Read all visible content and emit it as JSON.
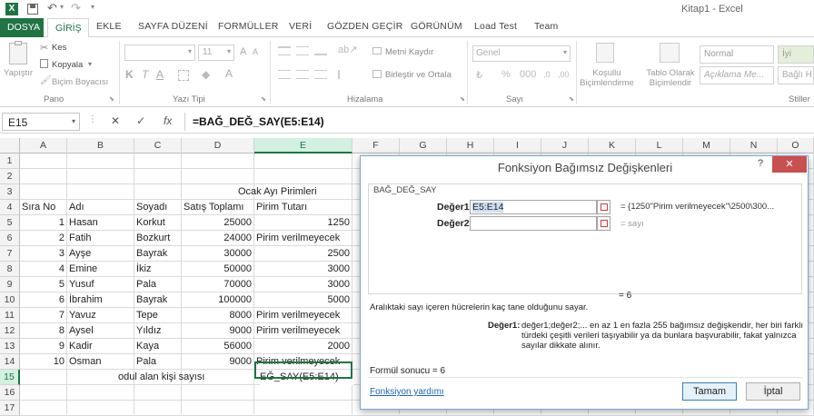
{
  "window": {
    "title": "Kitap1 - Excel",
    "quick_access": [
      "save-icon",
      "undo-icon",
      "redo-icon"
    ]
  },
  "tabs": [
    {
      "label": "DOSYA",
      "active": false,
      "file": true
    },
    {
      "label": "GİRİŞ",
      "active": true
    },
    {
      "label": "EKLE"
    },
    {
      "label": "SAYFA DÜZENİ"
    },
    {
      "label": "FORMÜLLER"
    },
    {
      "label": "VERİ"
    },
    {
      "label": "GÖZDEN GEÇİR"
    },
    {
      "label": "GÖRÜNÜM"
    },
    {
      "label": "Load Test"
    },
    {
      "label": "Team"
    }
  ],
  "ribbon": {
    "clipboard": {
      "paste": "Yapıştır",
      "cut": "Kes",
      "copy": "Kopyala",
      "format_painter": "Biçim Boyacısı",
      "group": "Pano"
    },
    "font": {
      "name": "",
      "size": "11",
      "bold": "K",
      "italic": "T",
      "underline": "A",
      "group": "Yazı Tipi"
    },
    "alignment": {
      "wrap": "Metni Kaydır",
      "merge": "Birleştir ve Ortala",
      "group": "Hizalama"
    },
    "number": {
      "format": "Genel",
      "group": "Sayı"
    },
    "styles": {
      "conditional": "Koşullu Biçimlendirme",
      "table": "Tablo Olarak Biçimlendir",
      "normal": "Normal",
      "good": "İyi",
      "explanatory": "Açıklama Me...",
      "linked": "Bağlı H",
      "group": "Stiller"
    }
  },
  "formula_bar": {
    "name_box": "E15",
    "cancel": "✕",
    "enter": "✓",
    "fx": "fx",
    "formula": "=BAĞ_DEĞ_SAY(E5:E14)"
  },
  "columns": [
    "A",
    "B",
    "C",
    "D",
    "E",
    "F",
    "G",
    "H",
    "I",
    "J",
    "K",
    "L",
    "M",
    "N",
    "O"
  ],
  "rows": [
    "1",
    "2",
    "3",
    "4",
    "5",
    "6",
    "7",
    "8",
    "9",
    "10",
    "11",
    "12",
    "13",
    "14",
    "15",
    "16",
    "17"
  ],
  "sheet": {
    "title": "Ocak Ayı Pirimleri",
    "headers": [
      "Sıra No",
      "Adı",
      "Soyadı",
      "Satış Toplamı",
      "Pirim Tutarı"
    ],
    "data": [
      [
        "1",
        "Hasan",
        "Korkut",
        "25000",
        "1250"
      ],
      [
        "2",
        "Fatih",
        "Bozkurt",
        "24000",
        "Pirim verilmeyecek"
      ],
      [
        "3",
        "Ayşe",
        "Bayrak",
        "30000",
        "2500"
      ],
      [
        "4",
        "Emine",
        "İkiz",
        "50000",
        "3000"
      ],
      [
        "5",
        "Yusuf",
        "Pala",
        "70000",
        "3000"
      ],
      [
        "6",
        "İbrahim",
        "Bayrak",
        "100000",
        "5000"
      ],
      [
        "7",
        "Yavuz",
        "Tepe",
        "8000",
        "Pirim verilmeyecek"
      ],
      [
        "8",
        "Aysel",
        "Yıldız",
        "9000",
        "Pirim verilmeyecek"
      ],
      [
        "9",
        "Kadir",
        "Kaya",
        "56000",
        "2000"
      ],
      [
        "10",
        "Osman",
        "Pala",
        "9000",
        "Pirim verilmeyecek"
      ]
    ],
    "row15_label": "odul alan kişi sayısı",
    "row15_editing": "EĞ_SAY(E5:E14)"
  },
  "dialog": {
    "title": "Fonksiyon Bağımsız Değişkenleri",
    "help": "?",
    "close": "✕",
    "function": "BAĞ_DEĞ_SAY",
    "arg1_label": "Değer1",
    "arg1_value": "E5:E14",
    "arg1_result": "= {1250\"Pirim verilmeyecek\"\\2500\\300...",
    "arg2_label": "Değer2",
    "arg2_value": "",
    "arg2_result": "= sayı",
    "total": "= 6",
    "description": "Aralıktaki sayı içeren hücrelerin kaç tane olduğunu sayar.",
    "param_name": "Değer1:",
    "param_desc": "değer1;değer2;... en az 1 en fazla 255 bağımsız değişkendir, her biri farklı türdeki çeşitli verileri taşıyabilir ya da bunlara başvurabilir, fakat yalnızca sayılar dikkate alınır.",
    "result": "Formül sonucu =   6",
    "help_link": "Fonksiyon yardımı",
    "ok": "Tamam",
    "cancel": "İptal"
  },
  "colors": {
    "excel_green": "#217346",
    "tab_active": "#217346",
    "dialog_border": "#7fa6cf",
    "close_red": "#c75050",
    "link_blue": "#2266aa"
  }
}
